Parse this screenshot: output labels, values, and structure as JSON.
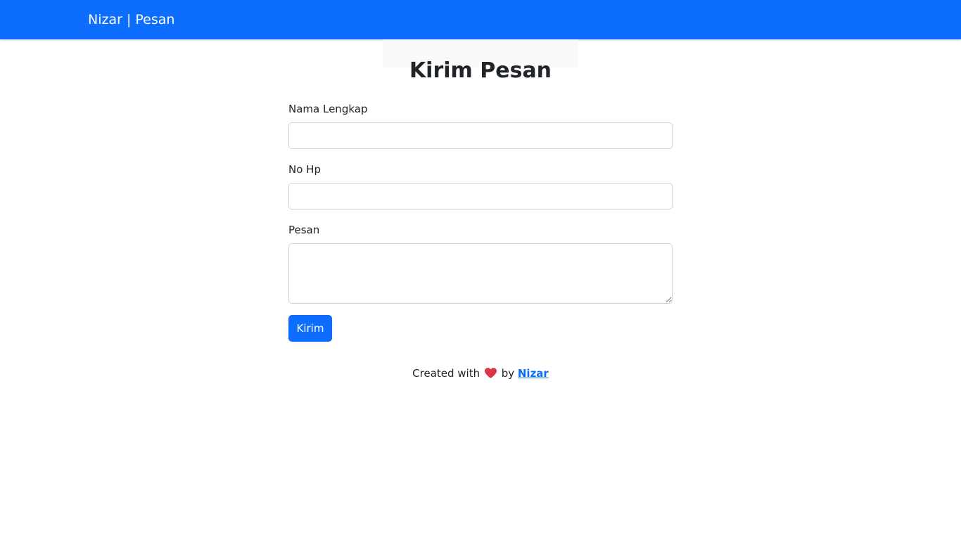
{
  "navbar": {
    "brand": "Nizar | Pesan"
  },
  "page": {
    "title": "Kirim Pesan"
  },
  "form": {
    "name_label": "Nama Lengkap",
    "name_value": "",
    "phone_label": "No Hp",
    "phone_value": "",
    "message_label": "Pesan",
    "message_value": "",
    "submit_label": "Kirim"
  },
  "footer": {
    "prefix": "Created with",
    "heart_icon": "heart-icon",
    "by": "by",
    "author_link": "Nizar"
  },
  "colors": {
    "primary": "#0d6efd",
    "heart": "#dc3545",
    "text": "#212529",
    "border": "#ced4da"
  }
}
